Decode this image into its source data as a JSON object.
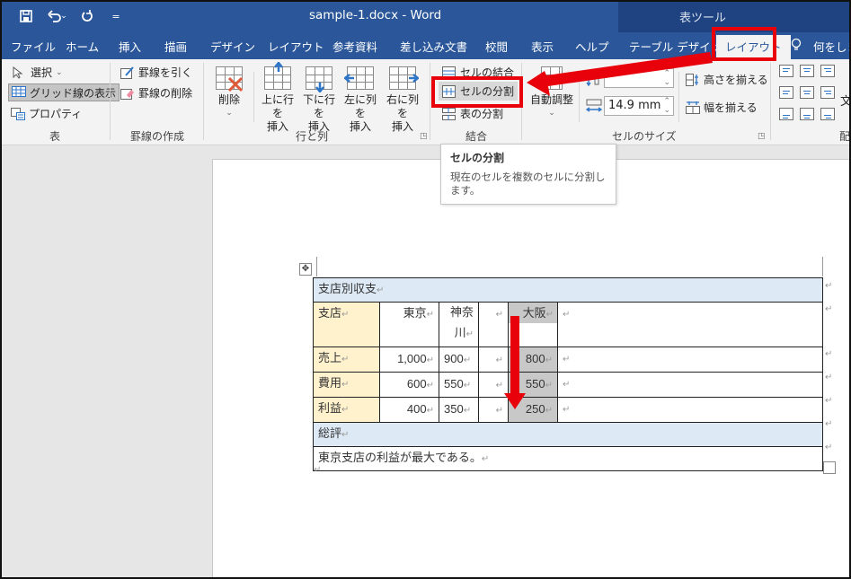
{
  "window": {
    "title": "sample-1.docx  -  Word",
    "context_group": "表ツール"
  },
  "quick_access": {
    "save_icon": "save-icon",
    "undo_icon": "undo-icon",
    "undo_dropdown": "ˇ",
    "redo_icon": "redo-icon",
    "customize": "="
  },
  "tabs": [
    {
      "label": "ファイル"
    },
    {
      "label": "ホーム"
    },
    {
      "label": "挿入"
    },
    {
      "label": "描画"
    },
    {
      "label": "デザイン"
    },
    {
      "label": "レイアウト"
    },
    {
      "label": "参考資料"
    },
    {
      "label": "差し込み文書"
    },
    {
      "label": "校閲"
    },
    {
      "label": "表示"
    },
    {
      "label": "ヘルプ"
    },
    {
      "label": "テーブル デザイン"
    },
    {
      "label": "レイアウト",
      "active": true
    }
  ],
  "tell_me": {
    "label": "何をしま"
  },
  "ribbon": {
    "table_group": {
      "label": "表",
      "select": "選択",
      "gridlines": "グリッド線の表示",
      "properties": "プロパティ"
    },
    "draw_group": {
      "label": "罫線の作成",
      "draw_table": "罫線を引く",
      "eraser": "罫線の削除"
    },
    "rows_cols_group": {
      "label": "行と列",
      "delete": "削除",
      "insert_above": [
        "上に行を",
        "挿入"
      ],
      "insert_below": [
        "下に行を",
        "挿入"
      ],
      "insert_left": [
        "左に列を",
        "挿入"
      ],
      "insert_right": [
        "右に列を",
        "挿入"
      ]
    },
    "merge_group": {
      "label": "結合",
      "merge_cells": "セルの結合",
      "split_cells": "セルの分割",
      "split_table": "表の分割"
    },
    "cell_size_group": {
      "label": "セルのサイズ",
      "autofit": "自動調整",
      "height_value": "",
      "width_value": "14.9 mm",
      "distribute_rows": "高さを揃える",
      "distribute_cols": "幅を揃える"
    },
    "alignment_group": {
      "label": "配",
      "text_direction": "文"
    }
  },
  "tooltip": {
    "title": "セルの分割",
    "body": "現在のセルを複数のセルに分割します。"
  },
  "document": {
    "table": {
      "title_row": "支店別収支",
      "header": [
        "支店",
        "東京",
        "神奈川",
        "",
        "大阪",
        ""
      ],
      "rows": [
        {
          "label": "売上",
          "tokyo": "1,000",
          "kanagawa": "900",
          "blank": "",
          "osaka": "800"
        },
        {
          "label": "費用",
          "tokyo": "600",
          "kanagawa": "550",
          "blank": "",
          "osaka": "550"
        },
        {
          "label": "利益",
          "tokyo": "400",
          "kanagawa": "350",
          "blank": "",
          "osaka": "250"
        }
      ],
      "summary_label": "総評",
      "summary_text": "東京支店の利益が最大である。"
    },
    "paragraph_mark": "↵"
  },
  "colors": {
    "ribbon_blue": "#2b579a",
    "context_blue": "#1f4380",
    "highlight_red": "#e8000b",
    "title_row_fill": "#dde9f5",
    "label_col_fill": "#fff2cc",
    "selected_cell_fill": "#c8c8c8"
  }
}
